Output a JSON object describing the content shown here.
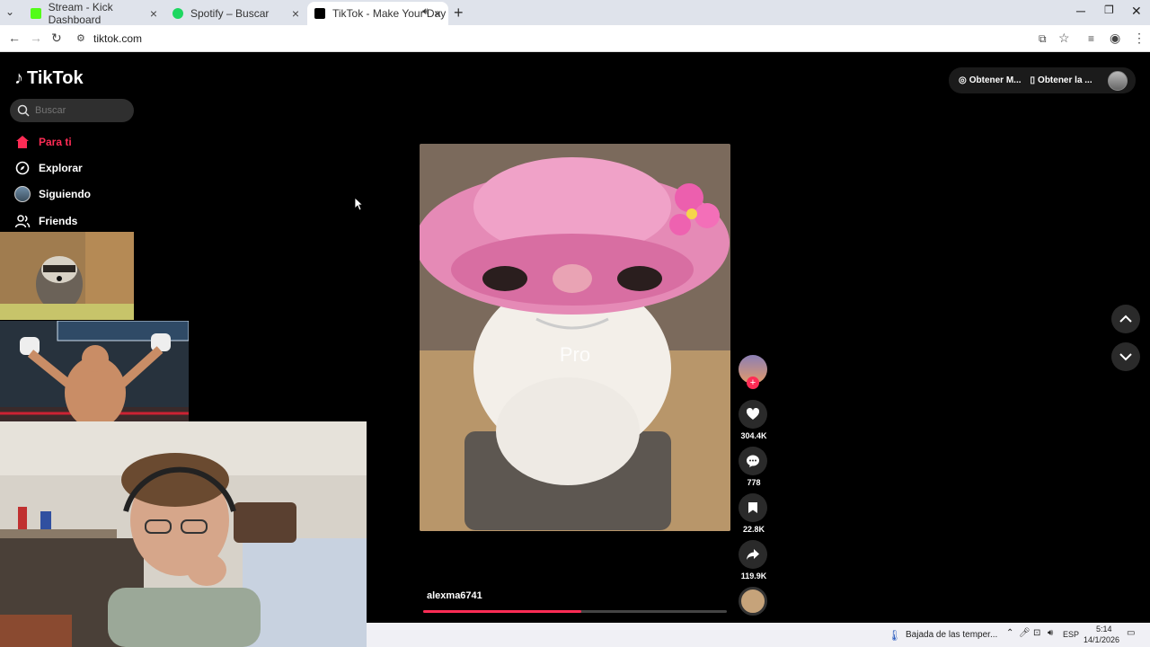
{
  "browser": {
    "tabs": [
      {
        "title": "Stream - Kick Dashboard",
        "color": "#53fc18"
      },
      {
        "title": "Spotify – Buscar",
        "color": "#1ed760"
      },
      {
        "title": "TikTok - Make Your Day",
        "color": "#000000"
      }
    ],
    "url": "tiktok.com"
  },
  "tiktok": {
    "logo": "TikTok",
    "search_placeholder": "Buscar",
    "nav": [
      {
        "label": "Para ti",
        "icon": "home-icon"
      },
      {
        "label": "Explorar",
        "icon": "compass-icon"
      },
      {
        "label": "Siguiendo",
        "icon": "following-avatar-icon"
      },
      {
        "label": "Friends",
        "icon": "friends-icon"
      }
    ],
    "top_right": {
      "coins_label": "Obtener M...",
      "app_label": "Obtener la ..."
    },
    "video": {
      "caption": "Pro",
      "author": "alexma6741",
      "progress": 0.52,
      "likes": "304.4K",
      "comments": "778",
      "saves": "22.8K",
      "shares": "119.9K"
    }
  },
  "taskbar": {
    "weather": "Bajada de las temper...",
    "lang": "ESP",
    "time": "5:14",
    "date": "14/1/2026"
  },
  "colors": {
    "accent": "#fe2c55",
    "background": "#000000"
  }
}
